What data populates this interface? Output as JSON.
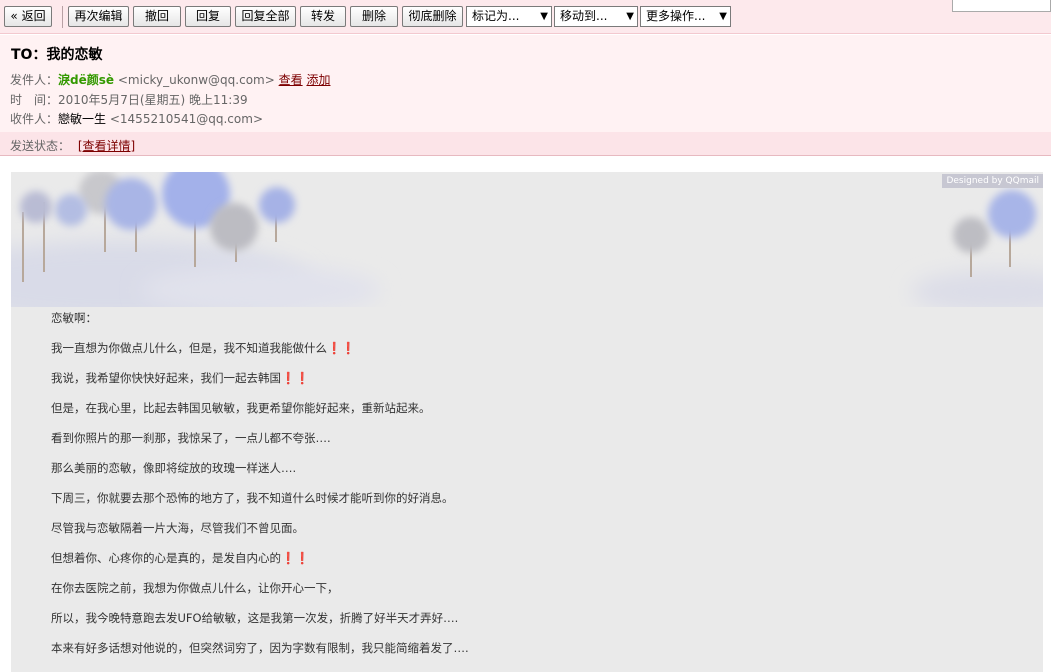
{
  "toolbar": {
    "back": "« 返回",
    "reedit": "再次编辑",
    "recall": "撤回",
    "reply": "回复",
    "reply_all": "回复全部",
    "forward": "转发",
    "delete": "删除",
    "delete_forever": "彻底删除",
    "mark_as": "标记为...",
    "move_to": "移动到...",
    "more_actions": "更多操作..."
  },
  "header": {
    "subject": "TO：我的恋敏",
    "sender_label": "发件人：",
    "sender_name": "淚dё颜sè",
    "sender_addr": "<micky_ukonw@qq.com>",
    "view_link": "查看",
    "add_link": "添加",
    "time_label": "时　间：",
    "time_value": "2010年5月7日(星期五) 晚上11:39",
    "recipient_label": "收件人：",
    "recipient_name": "戀敏一生",
    "recipient_addr": "<1455210541@qq.com>",
    "status_label": "发送状态：",
    "status_link": "[查看详情]"
  },
  "content": {
    "designed_by": "Designed by QQmail",
    "lines": [
      "恋敏啊：",
      "我一直想为你做点儿什么，但是，我不知道我能做什么❗❗",
      "我说，我希望你快快好起来，我们一起去韩国❗❗",
      "但是，在我心里，比起去韩国见敏敏，我更希望你能好起来，重新站起来。",
      "看到你照片的那一刹那，我惊呆了，一点儿都不夸张….",
      "那么美丽的恋敏，像即将绽放的玫瑰一样迷人….",
      "下周三，你就要去那个恐怖的地方了，我不知道什么时候才能听到你的好消息。",
      "尽管我与恋敏隔着一片大海，尽管我们不曾见面。",
      "但想着你、心疼你的心是真的，是发自内心的❗❗",
      "在你去医院之前，我想为你做点儿什么，让你开心一下，",
      "所以，我今晚特意跑去发UFO给敏敏，这是我第一次发，折腾了好半天才弄好….",
      "本来有好多话想对他说的，但突然词穷了，因为字数有限制，我只能简缩着发了…."
    ]
  }
}
